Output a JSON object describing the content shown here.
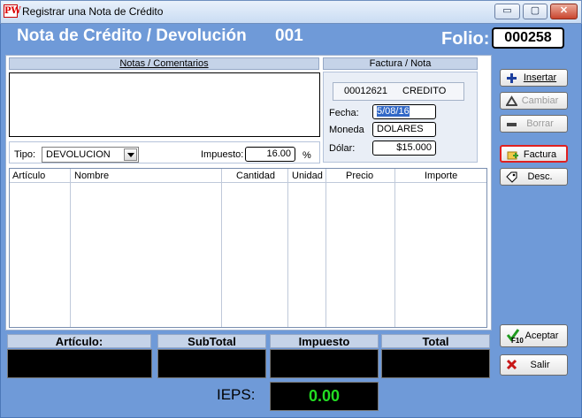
{
  "window": {
    "app_logo": "PW",
    "title": "Registrar una Nota de Crédito",
    "controls": {
      "minimize": "▭",
      "maximize": "▢",
      "close": "✕"
    }
  },
  "header": {
    "doc_title": "Nota de Crédito / Devolución",
    "doc_number": "001",
    "folio_label": "Folio:",
    "folio_value": "000258"
  },
  "notas": {
    "label": "Notas / Comentarios",
    "value": ""
  },
  "factura": {
    "label": "Factura / Nota",
    "number": "00012621",
    "type": "CREDITO",
    "fecha_label": "Fecha:",
    "fecha_value": "5/08/16",
    "moneda_label": "Moneda",
    "moneda_value": "DOLARES",
    "dolar_label": "Dólar:",
    "dolar_value": "$15.000"
  },
  "tipo": {
    "label": "Tipo:",
    "value": "DEVOLUCION"
  },
  "impuesto": {
    "label": "Impuesto:",
    "value": "16.00",
    "unit": "%"
  },
  "grid": {
    "columns": [
      "Artículo",
      "Nombre",
      "Cantidad",
      "Unidad",
      "Precio",
      "Importe"
    ],
    "rows": []
  },
  "buttons": {
    "insertar": "Insertar",
    "cambiar": "Cambiar",
    "borrar": "Borrar",
    "factura": "Factura",
    "desc": "Desc.",
    "aceptar": "Aceptar",
    "aceptar_key": "F10",
    "salir": "Salir"
  },
  "totals": {
    "articulo_label": "Artículo:",
    "subtotal_label": "SubTotal",
    "impuesto_label": "Impuesto",
    "total_label": "Total",
    "ieps_label": "IEPS:",
    "ieps_value": "0.00"
  },
  "colors": {
    "window_bg": "#6f9ad8",
    "section_head": "#c5d3e8",
    "ieps_value": "#22dd22",
    "highlight_border": "#e02020"
  }
}
